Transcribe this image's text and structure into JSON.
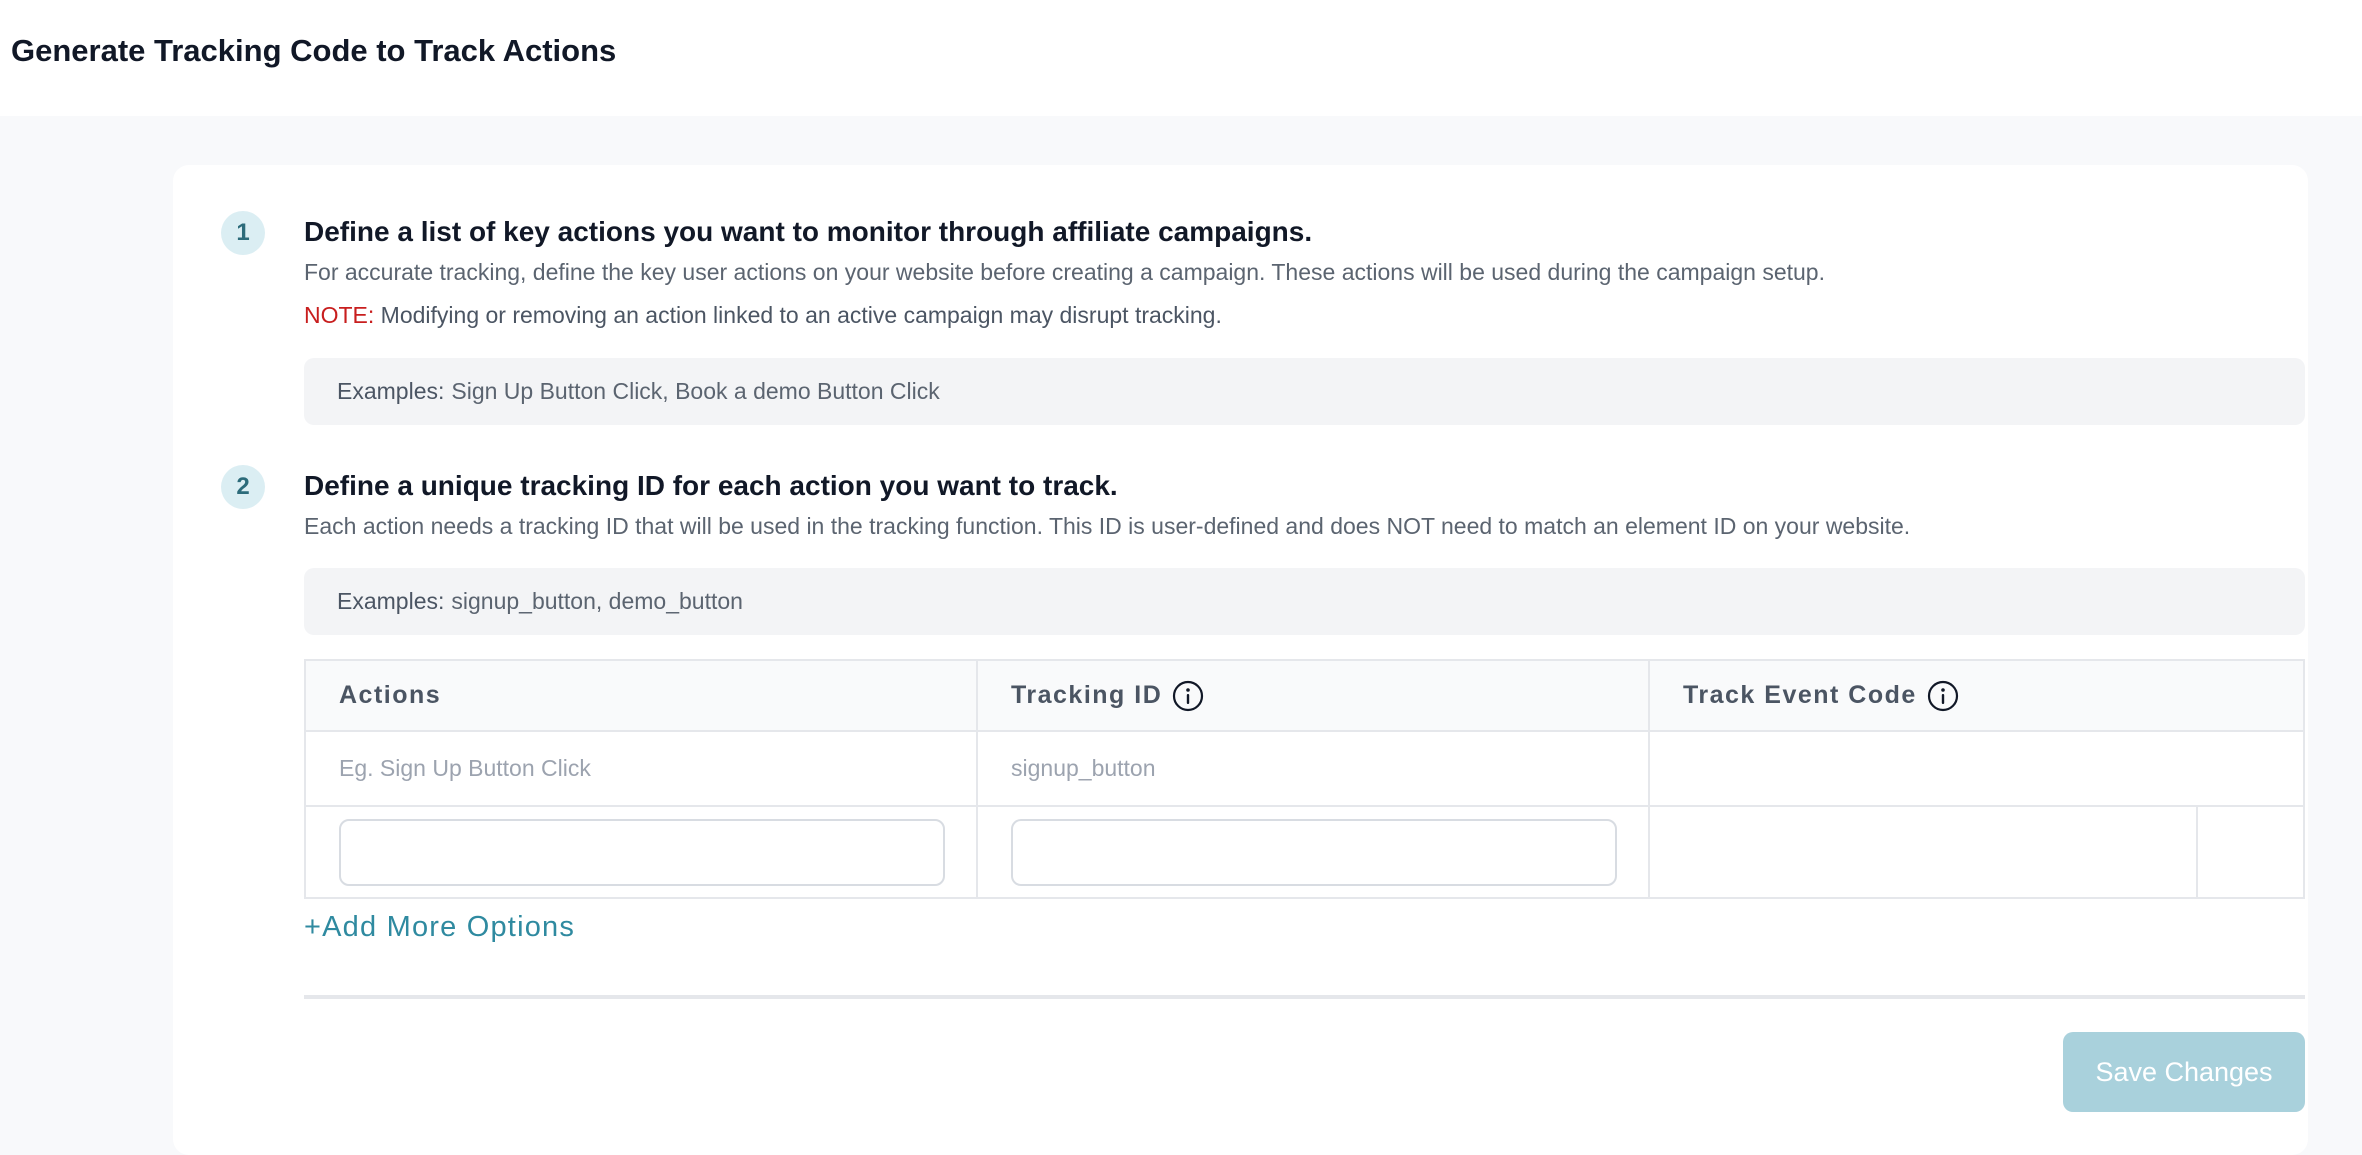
{
  "header": {
    "title": "Generate Tracking Code to Track Actions"
  },
  "steps": [
    {
      "number": "1",
      "title": "Define a list of key actions you want to monitor through affiliate campaigns.",
      "description": "For accurate tracking, define the key user actions on your website before creating a campaign. These actions will be used during the campaign setup.",
      "note_label": "NOTE:",
      "note_text": "Modifying or removing an action linked to an active campaign may disrupt tracking.",
      "examples_label": "Examples:",
      "examples_text": "Sign Up Button Click, Book a demo Button Click"
    },
    {
      "number": "2",
      "title": "Define a unique tracking ID for each action you want to track.",
      "description": "Each action needs a tracking ID that will be used in the tracking function. This ID is user-defined and does NOT need to match an element ID on your website.",
      "examples_label": "Examples:",
      "examples_text": "signup_button, demo_button"
    }
  ],
  "table": {
    "headers": [
      "Actions",
      "Tracking ID",
      "Track Event Code"
    ],
    "example_row": [
      "Eg. Sign Up Button Click",
      "signup_button",
      ""
    ],
    "input_row": {
      "action_value": "",
      "tracking_id_value": ""
    }
  },
  "add_more_label": "+Add More Options",
  "save_label": "Save Changes",
  "colors": {
    "accent": "#2f8aa0",
    "save_disabled": "#a9d1dc",
    "note": "#c81e1e",
    "step_circle_bg": "#dbeef3"
  },
  "icons": {
    "info": "info-circle-icon"
  }
}
